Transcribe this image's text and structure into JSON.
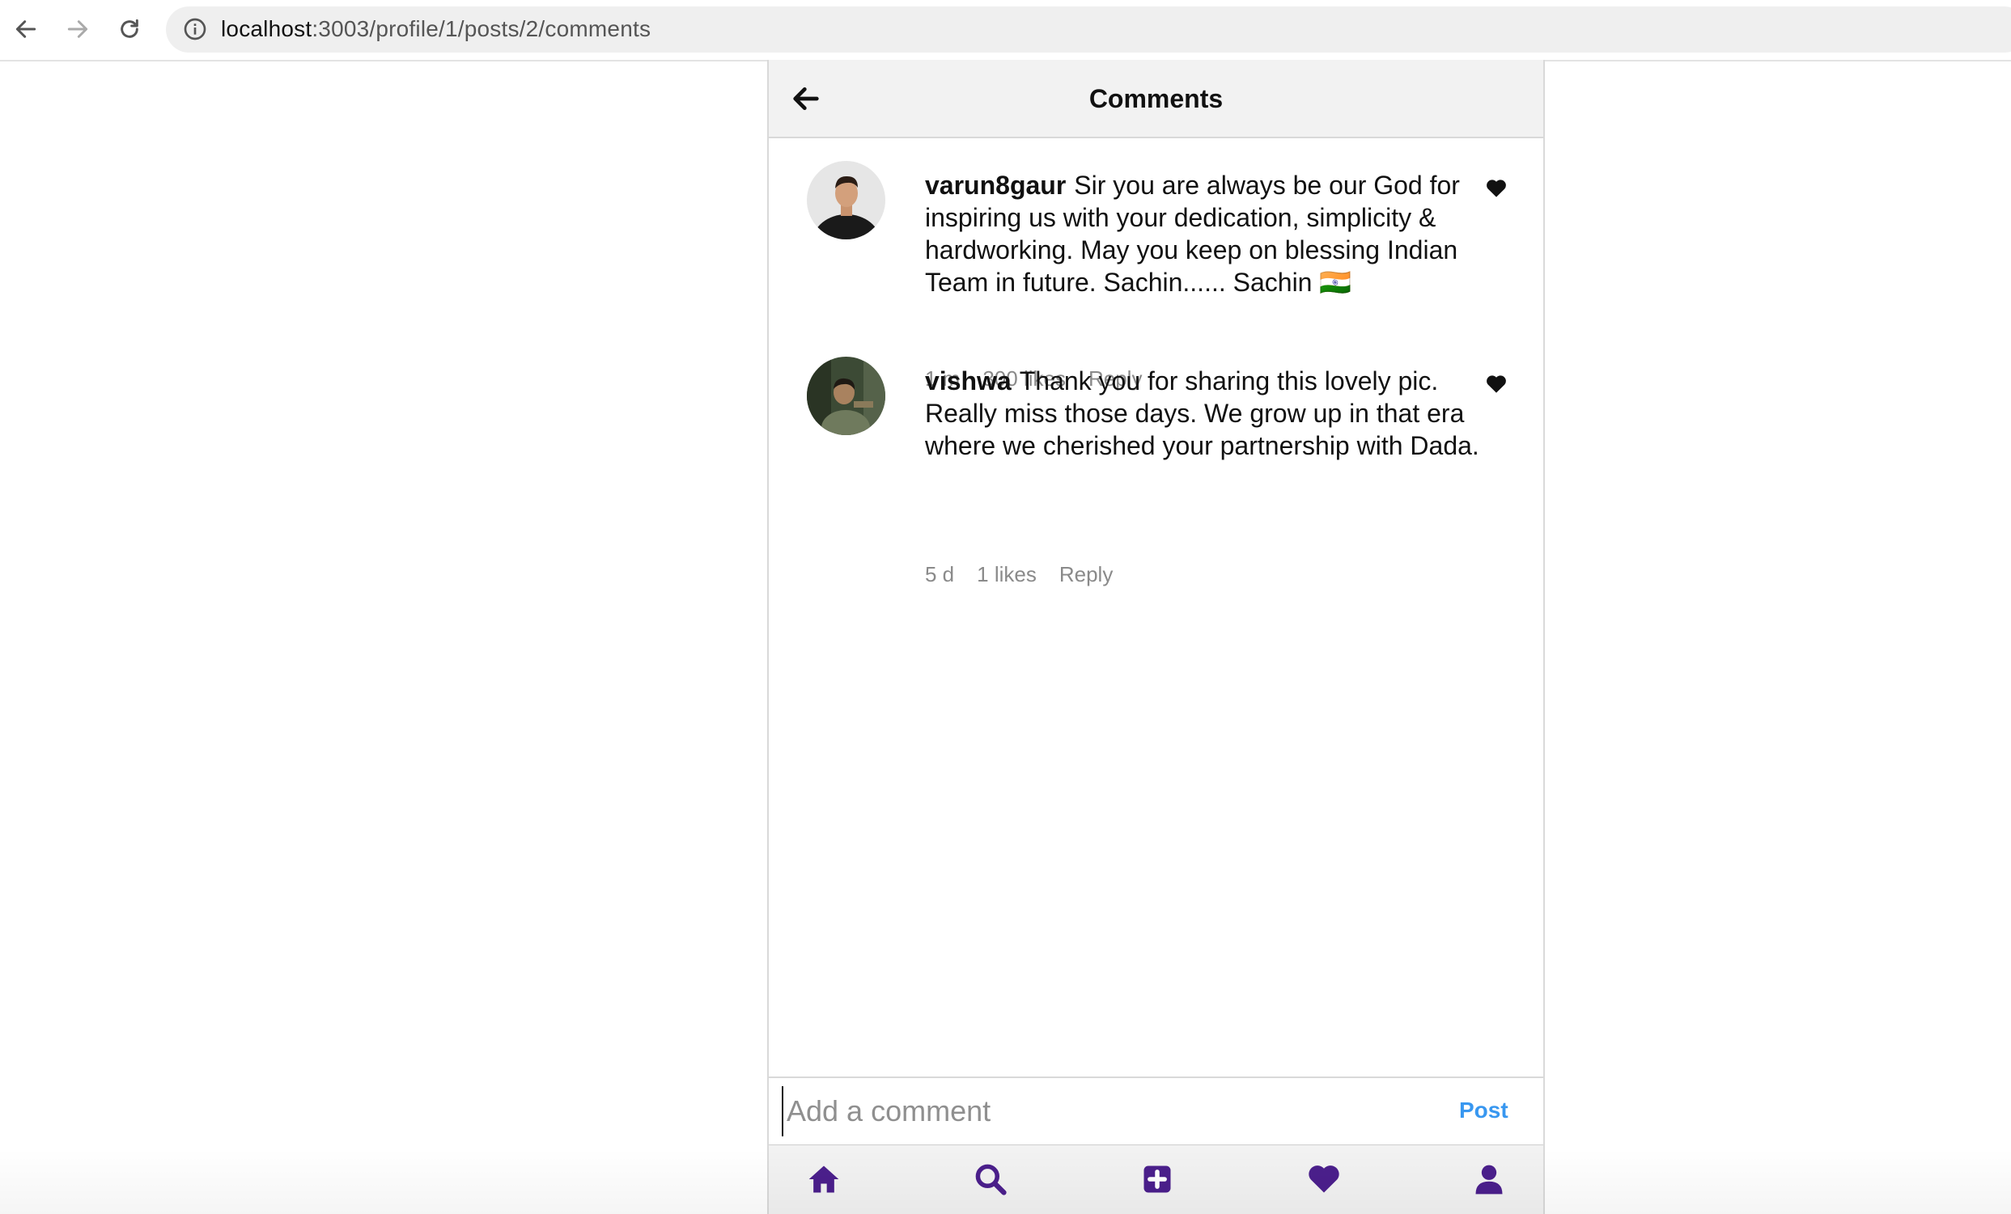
{
  "browser": {
    "url_host": "localhost",
    "url_path": ":3003/profile/1/posts/2/comments"
  },
  "header": {
    "title": "Comments"
  },
  "comments": [
    {
      "username": "varun8gaur",
      "text": "Sir you are always be our God for inspiring us with your dedication, simplicity & hardworking. May you keep on blessing Indian Team in future. Sachin...... Sachin 🇮🇳",
      "time": "1 m",
      "likes": "300 likes",
      "reply": "Reply"
    },
    {
      "username": "vishwa",
      "text": "Thank you for sharing this lovely pic. Really miss those days. We grow up in that era where we cherished your partnership with Dada.",
      "time": "5 d",
      "likes": "1 likes",
      "reply": "Reply"
    }
  ],
  "composer": {
    "placeholder": "Add a comment",
    "post_label": "Post"
  },
  "icons": {
    "back": "back-arrow-icon",
    "like": "heart-icon",
    "nav": [
      "home-icon",
      "search-icon",
      "add-post-icon",
      "heart-icon",
      "profile-icon"
    ]
  },
  "colors": {
    "accent": "#3897f0",
    "nav_icon": "#4b1f8c"
  }
}
